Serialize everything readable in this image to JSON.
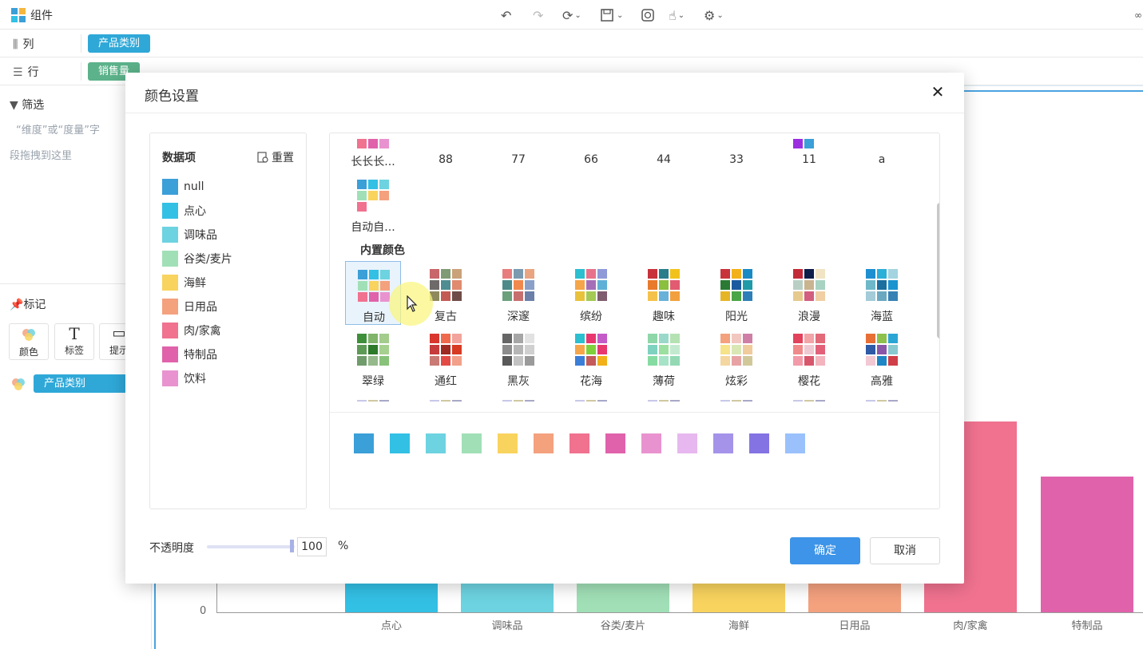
{
  "app": {
    "title": "组件"
  },
  "shelves": {
    "columns": {
      "label": "列",
      "pill": "产品类别"
    },
    "rows": {
      "label": "行",
      "pill": "销售量"
    }
  },
  "left": {
    "filter_title": "筛选",
    "filter_hint1": "“维度”或“度量”字",
    "filter_hint2": "段拖拽到这里",
    "marks_title": "标记",
    "mark_buttons": [
      "颜色",
      "标签",
      "提示"
    ],
    "color_field_pill": "产品类别"
  },
  "chart": {
    "y_zero": "0",
    "categories": [
      "点心",
      "调味品",
      "谷类/麦片",
      "海鲜",
      "日用品",
      "肉/家禽",
      "特制品"
    ]
  },
  "dialog": {
    "title": "颜色设置",
    "close_label": "✕",
    "items_title": "数据项",
    "reset_label": "重置",
    "items": [
      {
        "label": "null",
        "color": "#3b9fd8"
      },
      {
        "label": "点心",
        "color": "#33c0e5"
      },
      {
        "label": "调味品",
        "color": "#6dd3e0"
      },
      {
        "label": "谷类/麦片",
        "color": "#a1e0b7"
      },
      {
        "label": "海鲜",
        "color": "#f8d35e"
      },
      {
        "label": "日用品",
        "color": "#f4a17e"
      },
      {
        "label": "肉/家禽",
        "color": "#f0728f"
      },
      {
        "label": "特制品",
        "color": "#e062ab"
      },
      {
        "label": "饮料",
        "color": "#e893cf"
      }
    ],
    "custom_schemes": [
      "长长长...",
      "88",
      "77",
      "66",
      "44",
      "33",
      "11",
      "a",
      "自动自..."
    ],
    "builtin_title": "内置颜色",
    "builtin_schemes": [
      "自动",
      "复古",
      "深邃",
      "缤纷",
      "趣味",
      "阳光",
      "浪漫",
      "海蓝",
      "翠绿",
      "通红",
      "黑灰",
      "花海",
      "薄荷",
      "炫彩",
      "樱花",
      "高雅"
    ],
    "palette": [
      "#3b9fd8",
      "#33c0e5",
      "#6dd3e0",
      "#a1e0b7",
      "#f8d35e",
      "#f4a17e",
      "#f0728f",
      "#e062ab",
      "#e893cf",
      "#e6b8ef",
      "#a593ea",
      "#8474e3",
      "#9ac1fb"
    ],
    "opacity_label": "不透明度",
    "opacity_value": "100",
    "opacity_unit": "%",
    "ok_label": "确定",
    "cancel_label": "取消"
  }
}
